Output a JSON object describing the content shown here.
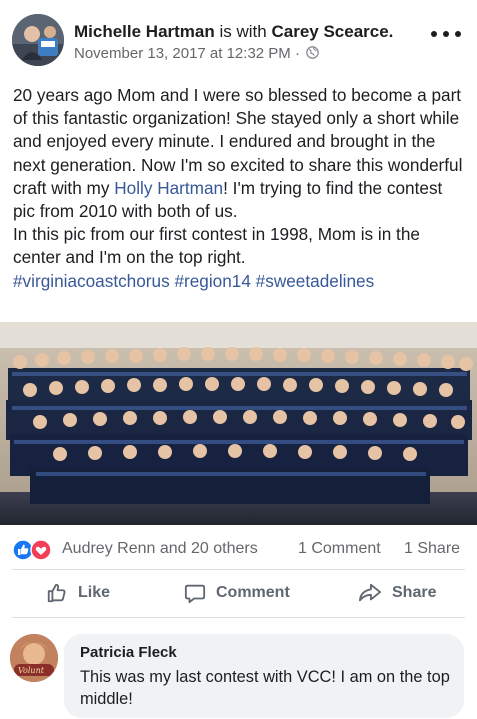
{
  "post": {
    "author": "Michelle Hartman",
    "with_text": "is with",
    "tagged": "Carey Scearce.",
    "timestamp": "November 13, 2017 at 12:32 PM ·",
    "privacy_icon": "globe-icon",
    "more_icon": "more-options-icon",
    "body": {
      "p1_a": "20 years ago Mom and I were so blessed to become a part of this fantastic organization! She stayed only a short while and enjoyed every minute. I endured and brought in the next generation. Now I'm so excited to share this wonderful craft with my ",
      "p1_link": "Holly Hartman",
      "p1_b": "! I'm trying to find the contest pic from 2010 with both of us.",
      "p2": "In this pic from our first contest in 1998, Mom is in the center and I'm on the top right.",
      "hashtags": "#virginiacoastchorus #region14 #sweetadelines"
    }
  },
  "stats": {
    "reactions_text": "Audrey Renn and 20 others",
    "comments_text": "1 Comment",
    "shares_text": "1 Share",
    "reaction_icons": [
      "like-icon",
      "love-icon"
    ]
  },
  "actions": {
    "like": "Like",
    "comment": "Comment",
    "share": "Share"
  },
  "comment": {
    "author": "Patricia Fleck",
    "text": "This was my last contest with VCC! I am on the top middle!",
    "avatar_badge": "Volunt"
  },
  "colors": {
    "link": "#385898",
    "secondary_text": "#65676b",
    "like_blue": "#1877f2",
    "love_red": "#f33e58"
  }
}
